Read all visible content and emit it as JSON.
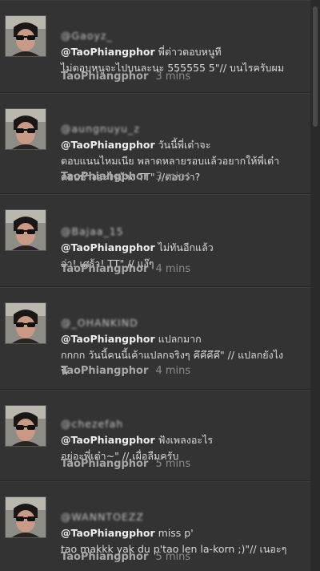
{
  "tweets": [
    {
      "blurred_mention": "@Gaoyz_",
      "reply_handle": "@TaoPhiangphor",
      "text": " พี่ต่าวตอบหนูที\nไม่ตอบหนูจะไปบนละนะ 555555 5\"// บนไรครับผม",
      "author": "TaoPhiangphor",
      "time": "3 mins"
    },
    {
      "blurred_mention": "@aungnuyu_z",
      "reply_handle": "@TaoPhiangphor",
      "text": " วันนี้พี่เต๋าจะ\nตอบแนนไหมเนีย พลาดหลายรอบแล้วอยากให้พี่เต๋า\nตอบบ้างอะไรบ้าง TT\" //ตอบว่า?",
      "author": "TaoPhiangphor",
      "time": "3 mins"
    },
    {
      "blurred_mention": "@Bajaa_15",
      "reply_handle": "@TaoPhiangphor",
      "text": " ไม่ทันอีกแล้ว\nอ่า! เศร้า! TT\" // แง๊ๆ",
      "author": "TaoPhiangphor",
      "time": "4 mins"
    },
    {
      "blurred_mention": "@_OHANKIND",
      "reply_handle": "@TaoPhiangphor",
      "text": " แปลกมาก\nกกกก วันนี้คนนี้เค้าแปลกจริงๆ คึคึคึคึ\" // แปลกยังไง\nนิ",
      "author": "TaoPhiangphor",
      "time": "4 mins"
    },
    {
      "blurred_mention": "@chezefah",
      "reply_handle": "@TaoPhiangphor",
      "text": " ฟังเพลงอะไร\nอยู่อะพี่เต๋า~\" // เผื่อลืมครับ",
      "author": "TaoPhiangphor",
      "time": "5 mins"
    },
    {
      "blurred_mention": "@WANNTOEZZ",
      "reply_handle": "@TaoPhiangphor",
      "text": " miss p'\ntao makkk yak du p'tao len la-korn ;)\"// เนอะๆ",
      "author": "TaoPhiangphor",
      "time": "5 mins"
    }
  ]
}
